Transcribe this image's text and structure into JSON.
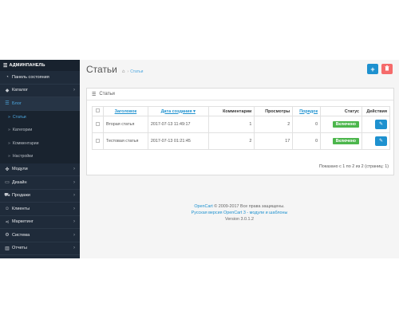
{
  "sidebar": {
    "header": "АДМИНПАНЕЛЬ",
    "items": [
      {
        "label": "Панель состояния",
        "icon": "dashboard-icon",
        "glyph": "◔",
        "chevron": false
      },
      {
        "label": "Каталог",
        "icon": "tag-icon",
        "glyph": "◆",
        "chevron": true
      },
      {
        "label": "Блог",
        "icon": "list-icon",
        "glyph": "☰",
        "chevron": false,
        "open": true
      }
    ],
    "subitems": [
      {
        "label": "Статьи",
        "active": true
      },
      {
        "label": "Категории"
      },
      {
        "label": "Комментарии"
      },
      {
        "label": "Настройки"
      }
    ],
    "items_after": [
      {
        "label": "Модули",
        "icon": "puzzle-icon",
        "glyph": "✤"
      },
      {
        "label": "Дизайн",
        "icon": "monitor-icon",
        "glyph": "▭"
      },
      {
        "label": "Продажи",
        "icon": "cart-icon",
        "glyph": "⛟"
      },
      {
        "label": "Клиенты",
        "icon": "user-icon",
        "glyph": "☺"
      },
      {
        "label": "Маркетинг",
        "icon": "share-icon",
        "glyph": "⋖"
      },
      {
        "label": "Система",
        "icon": "gear-icon",
        "glyph": "⚙"
      },
      {
        "label": "Отчеты",
        "icon": "bar-chart-icon",
        "glyph": "▥"
      }
    ]
  },
  "header": {
    "title": "Статьи",
    "breadcrumb_current": "Статьи",
    "add_glyph": "+",
    "delete_glyph": "🗑"
  },
  "panel": {
    "title": "Статьи",
    "columns": {
      "title": "Заголовок",
      "date": "Дата создания",
      "comments": "Комментарии",
      "views": "Просмотры",
      "order": "Порядок",
      "status": "Статус",
      "actions": "Действия"
    },
    "rows": [
      {
        "title": "Вторая статья",
        "date": "2017-07-13 11:49:17",
        "comments": "1",
        "views": "2",
        "order": "0",
        "status": "Включено"
      },
      {
        "title": "Тестовая статья",
        "date": "2017-07-13 01:21:45",
        "comments": "2",
        "views": "17",
        "order": "0",
        "status": "Включено"
      }
    ],
    "pagination": "Показано с 1 по 2 из 2 (страниц: 1)"
  },
  "footer": {
    "brand": "OpenCart",
    "copyright": " © 2009-2017 Все права защищены.",
    "russian_link": "Русская версия OpenCart 3 - модули и шаблоны",
    "version": "Version 3.0.1.2"
  },
  "colors": {
    "sidebar_bg": "#1f2b3a",
    "accent": "#1e91cf",
    "danger": "#f56b6b",
    "success": "#4cb64c"
  }
}
